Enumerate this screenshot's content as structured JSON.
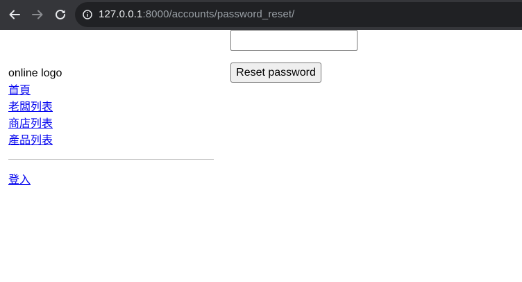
{
  "browser": {
    "url_host": "127.0.0.1",
    "url_rest": ":8000/accounts/password_reset/"
  },
  "sidebar": {
    "logo": "online logo",
    "links": [
      "首頁",
      "老闆列表",
      "商店列表",
      "產品列表"
    ],
    "login": "登入"
  },
  "form": {
    "email_value": "",
    "submit_label": "Reset password"
  }
}
